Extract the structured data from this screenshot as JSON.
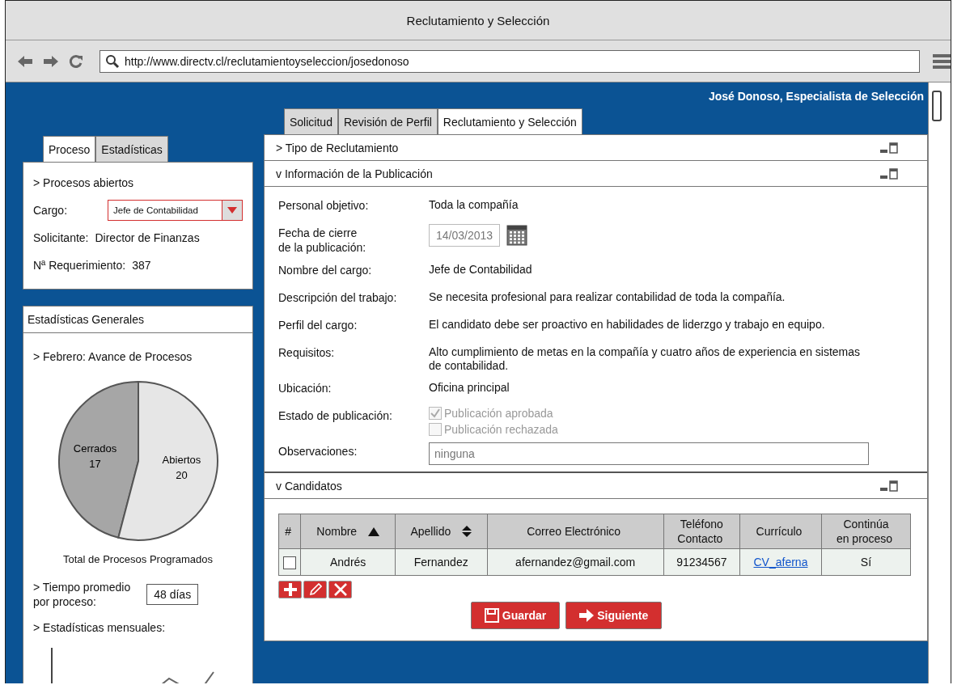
{
  "window": {
    "title": "Reclutamiento y Selección"
  },
  "browser": {
    "url": "http://www.directv.cl/reclutamientoyseleccion/josedonoso"
  },
  "user": "José Donoso, Especialista de Selección",
  "side_tabs": [
    {
      "label": "Proceso",
      "selected": true
    },
    {
      "label": "Estadísticas",
      "selected": false
    }
  ],
  "process": {
    "heading": "> Procesos abiertos",
    "cargo_label": "Cargo:",
    "cargo_value": "Jefe de Contabilidad",
    "solicitante_label": "Solicitante:",
    "solicitante_value": "Director de Finanzas",
    "req_label": "Nª Requerimiento:",
    "req_value": "387"
  },
  "stats": {
    "title": "Estadísticas Generales",
    "heading": "> Febrero: Avance de Procesos",
    "chart_data": {
      "type": "pie",
      "categories": [
        "Cerrados",
        "Abiertos"
      ],
      "values": [
        17,
        20
      ],
      "xlabel": "Total de Procesos Programados",
      "data_labels": true
    },
    "avg_label": "> Tiempo promedio\npor proceso:",
    "avg_value": "48 días",
    "monthly": "> Estadísticas mensuales:"
  },
  "main_tabs": [
    {
      "label": "Solicitud",
      "selected": false
    },
    {
      "label": "Revisión de Perfil",
      "selected": false
    },
    {
      "label": "Reclutamiento y Selección",
      "selected": true
    }
  ],
  "sections": [
    {
      "title": "> Tipo de Reclutamiento",
      "expanded": false
    },
    {
      "title": "v Información de la Publicación",
      "expanded": true
    },
    {
      "title": "v Candidatos",
      "expanded": true
    }
  ],
  "publication": {
    "fields": [
      {
        "kind": "text",
        "label": "Personal objetivo:",
        "value": "Toda la compañía"
      },
      {
        "kind": "date",
        "label": "Fecha de cierre\nde la publicación:",
        "value": "14/03/2013"
      },
      {
        "kind": "text",
        "label": "Nombre del cargo:",
        "value": "Jefe de Contabilidad"
      },
      {
        "kind": "text",
        "label": "Descripción del trabajo:",
        "value": "Se necesita profesional para realizar contabilidad de toda la compañía."
      },
      {
        "kind": "text",
        "label": "Perfil del cargo:",
        "value": "El candidato debe ser proactivo en habilidades de liderzgo y trabajo en equipo."
      },
      {
        "kind": "text",
        "label": "Requisitos:",
        "value": "Alto cumplimiento de metas en la compañía y cuatro años de experiencia en sistemas de contabilidad."
      },
      {
        "kind": "text",
        "label": "Ubicación:",
        "value": "Oficina principal"
      },
      {
        "kind": "checks",
        "label": "Estado de publicación:",
        "options": [
          {
            "label": "Publicación aprobada",
            "checked": true,
            "disabled": true
          },
          {
            "label": "Publicación rechazada",
            "checked": false,
            "disabled": true
          }
        ]
      },
      {
        "kind": "input",
        "label": "Observaciones:",
        "value": "ninguna"
      }
    ]
  },
  "candidates": {
    "columns": [
      {
        "label": "#"
      },
      {
        "label": "Nombre",
        "kind": "sort_asc"
      },
      {
        "label": "Apellido",
        "kind": "sort_both"
      },
      {
        "label": "Correo Electrónico"
      },
      {
        "label": "Teléfono\nContacto"
      },
      {
        "label": "Currículo"
      },
      {
        "label": "Continúa\nen proceso"
      }
    ],
    "rows": [
      {
        "checked": false,
        "nombre": "Andrés",
        "apellido": "Fernandez",
        "correo": "afernandez@gmail.com",
        "telefono": "91234567",
        "curriculo": "CV_aferna",
        "continua": "Sí"
      }
    ]
  },
  "buttons": [
    {
      "kind": "save",
      "label": "Guardar"
    },
    {
      "kind": "next",
      "label": "Siguiente"
    }
  ]
}
